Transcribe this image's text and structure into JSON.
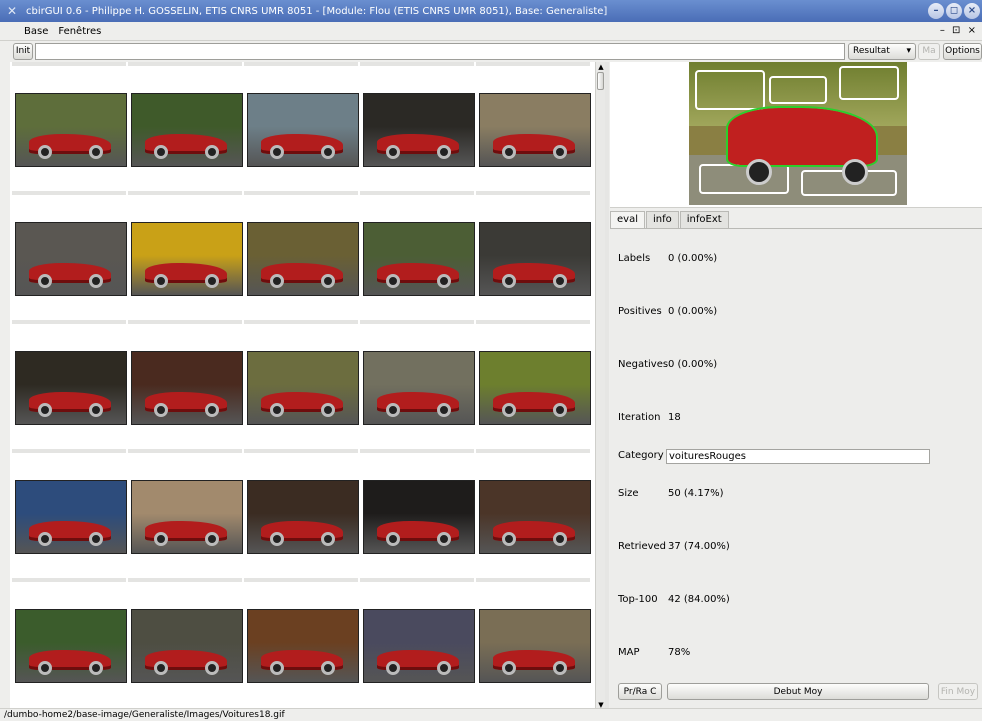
{
  "window": {
    "title": "cbirGUI 0.6 - Philippe H. GOSSELIN, ETIS CNRS UMR 8051 - [Module: Flou (ETIS CNRS UMR 8051), Base: Generaliste]",
    "minimize_icon": "minimize-icon",
    "restore_icon": "restore-icon",
    "close_icon": "close-icon"
  },
  "menu": {
    "base": "Base",
    "fenetres": "Fenêtres",
    "mdi_controls": "– ⊡ ×"
  },
  "toolbar": {
    "init_label": "Init",
    "query_value": "",
    "result_value": "Resultat",
    "disabled_label": "Ma",
    "options_label": "Options"
  },
  "panel": {
    "tabs": [
      {
        "label": "eval"
      },
      {
        "label": "info"
      },
      {
        "label": "infoExt"
      }
    ],
    "stats": [
      {
        "label": "Labels",
        "value": "0 (0.00%)"
      },
      {
        "label": "Positives",
        "value": "0 (0.00%)"
      },
      {
        "label": "Negatives",
        "value": "0 (0.00%)"
      },
      {
        "label": "Iteration",
        "value": "18"
      },
      {
        "label": "Category",
        "value": "voituresRouges"
      },
      {
        "label": "Size",
        "value": "50 (4.17%)"
      },
      {
        "label": "Retrieved",
        "value": "37 (74.00%)"
      },
      {
        "label": "Top-100",
        "value": "42 (84.00%)"
      },
      {
        "label": "MAP",
        "value": "78%"
      }
    ],
    "buttons": {
      "pr_ra": "Pr/Ra C",
      "debut_moy": "Debut Moy",
      "fin_moy": "Fin Moy"
    }
  },
  "status_bar": {
    "path": "/dumbo-home2/base-image/Generaliste/Images/Voitures18.gif"
  },
  "grid": {
    "rows": 5,
    "cols": 5,
    "backgrounds": [
      "#5e6e3b",
      "#3f5a2a",
      "#6d7f88",
      "#2b2925",
      "#8a7d62",
      "#5a5752",
      "#c9a117",
      "#6a6034",
      "#4c5e35",
      "#3b3a36",
      "#2e2a22",
      "#4a2a1f",
      "#6c6d3f",
      "#72705f",
      "#6d7f2e",
      "#2d4c7c",
      "#a28a6d",
      "#3b2c22",
      "#1e1c1b",
      "#4b3528",
      "#3b5c2c",
      "#4e4e42",
      "#6b4021",
      "#4a4a5e",
      "#7a6e55"
    ]
  },
  "colors": {
    "accent": "#4a6db6",
    "car_red": "#b21d1d",
    "segment_green": "#2ccf2c"
  }
}
